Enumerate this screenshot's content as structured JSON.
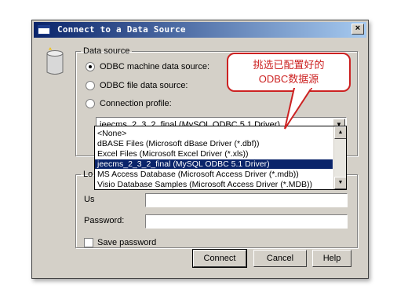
{
  "window": {
    "title": "Connect to a Data Source",
    "close_glyph": "×"
  },
  "data_source": {
    "legend": "Data source",
    "options": [
      {
        "label": "ODBC machine data source:",
        "selected": true
      },
      {
        "label": "ODBC file data source:",
        "selected": false
      },
      {
        "label": "Connection profile:",
        "selected": false
      }
    ],
    "combo_value": "jeecms_2_3_2_final (MySQL ODBC 5.1 Driver)",
    "dropdown_items": [
      "<None>",
      "dBASE Files (Microsoft dBase Driver (*.dbf))",
      "Excel Files (Microsoft Excel Driver (*.xls))",
      "jeecms_2_3_2_final (MySQL ODBC 5.1 Driver)",
      "MS Access Database (Microsoft Access Driver (*.mdb))",
      "Visio Database Samples (Microsoft Access Driver (*.MDB))"
    ],
    "dropdown_selected_index": 3
  },
  "login": {
    "legend": "Lo",
    "user_label": "Us",
    "password_label": "Password:",
    "save_password_label": "Save password"
  },
  "buttons": {
    "connect": "Connect",
    "cancel": "Cancel",
    "help": "Help"
  },
  "callout": {
    "line1": "挑选已配置好的",
    "line2": "ODBC数据源"
  },
  "colors": {
    "title_start": "#0a246a",
    "title_end": "#a6caf0",
    "callout": "#cc2222",
    "selection": "#0a246a"
  }
}
